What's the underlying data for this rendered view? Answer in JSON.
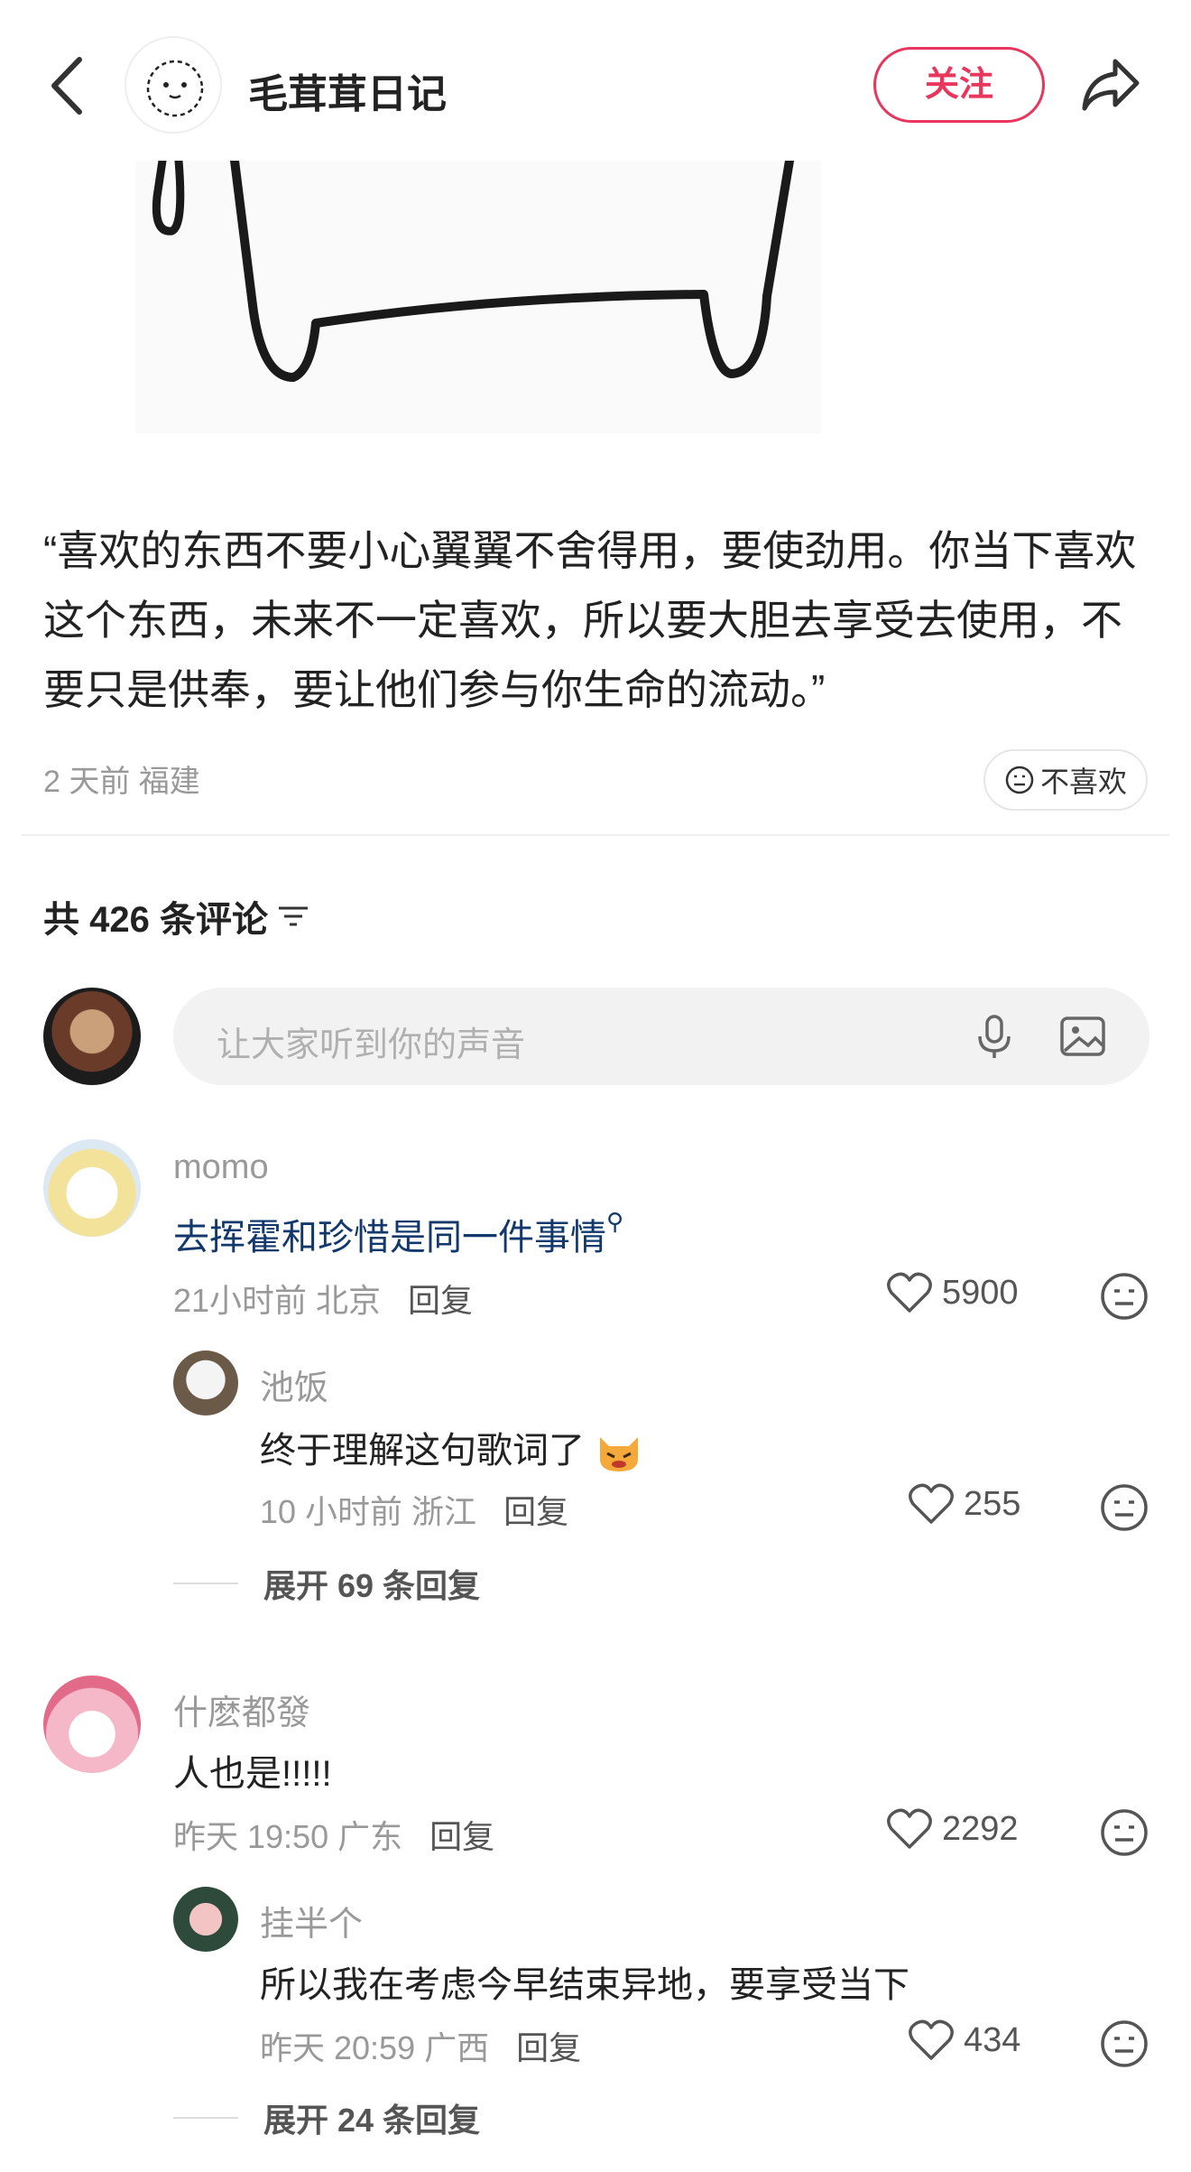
{
  "header": {
    "author_name": "毛茸茸日记",
    "follow_label": "关注"
  },
  "post": {
    "text": "“喜欢的东西不要小心翼翼不舍得用，要使劲用。你当下喜欢这个东西，未来不一定喜欢，所以要大胆去享受去使用，不要只是供奉，要让他们参与你生命的流动。”",
    "meta": "2 天前 福建",
    "dislike_label": "不喜欢"
  },
  "comments_section": {
    "count_label": "共 426 条评论",
    "input_placeholder": "让大家听到你的声音"
  },
  "comments": [
    {
      "name": "momo",
      "text": "去挥霍和珍惜是同一件事情",
      "meta": "21小时前 北京",
      "reply_label": "回复",
      "likes": "5900",
      "replies": [
        {
          "name": "池饭",
          "text": "终于理解这句歌词了",
          "meta": "10 小时前 浙江",
          "reply_label": "回复",
          "likes": "255"
        }
      ],
      "expand_label": "展开 69 条回复"
    },
    {
      "name": "什麽都發",
      "text": "人也是!!!!!",
      "meta": "昨天 19:50 广东",
      "reply_label": "回复",
      "likes": "2292",
      "replies": [
        {
          "name": "挂半个",
          "text": "所以我在考虑今早结束异地，要享受当下",
          "meta": "昨天 20:59 广西",
          "reply_label": "回复",
          "likes": "434"
        }
      ],
      "expand_label": "展开 24 条回复"
    }
  ],
  "colors": {
    "accent": "#e8365d",
    "link": "#13386c",
    "muted": "#999999"
  }
}
